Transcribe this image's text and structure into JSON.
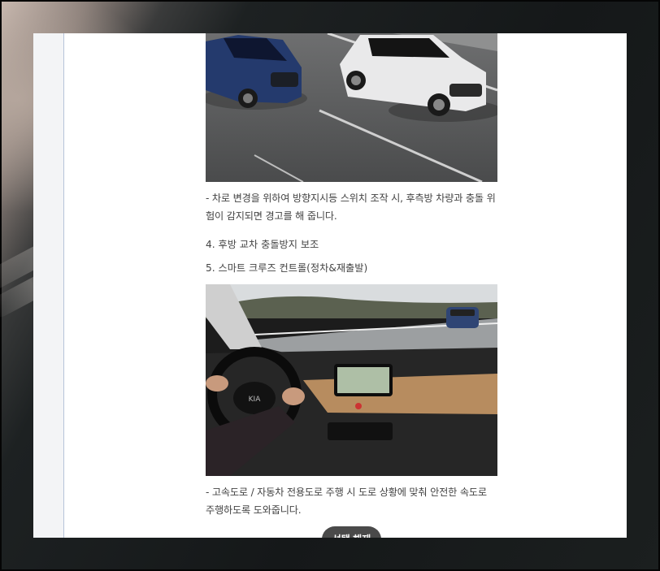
{
  "article": {
    "caption1": "- 차로 변경을 위하여 방향지시등 스위치 조작 시, 후측방 차량과 충돌 위험이 감지되면 경고를 해 줍니다.",
    "heading4": "4. 후방 교차 충돌방지 보조",
    "heading5": "5. 스마트 크루즈 컨트롤(정차&재출발)",
    "caption2": "- 고속도로 / 자동차 전용도로 주행 시 도로 상황에 맞춰 안전한 속도로 주행하도록 도와줍니다."
  },
  "images": {
    "image1": "blind-spot-warning-suvs-on-highway-photo",
    "image2": "smart-cruise-control-cockpit-photo",
    "steering_logo": "KIA"
  },
  "controls": {
    "release_selection": "선택 해제"
  },
  "colors": {
    "text": "#444444",
    "button_bg": "#4a4a4a",
    "gutter_border": "#b7c3d9"
  }
}
